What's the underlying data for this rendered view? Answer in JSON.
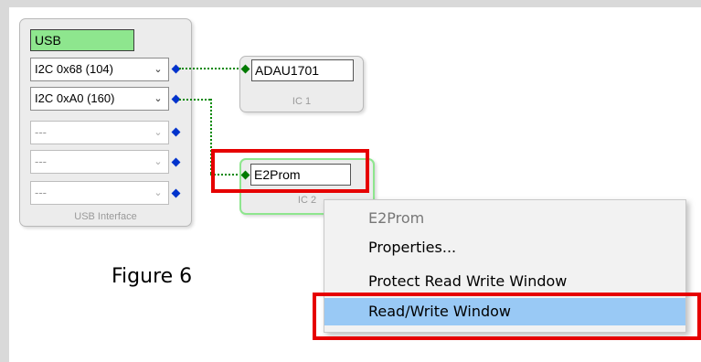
{
  "usb_interface": {
    "title": "USB",
    "footer": "USB Interface",
    "ports": [
      {
        "label": "I2C 0x68 (104)",
        "enabled": true
      },
      {
        "label": "I2C 0xA0 (160)",
        "enabled": true
      },
      {
        "label": "---",
        "enabled": false
      },
      {
        "label": "---",
        "enabled": false
      },
      {
        "label": "---",
        "enabled": false
      }
    ]
  },
  "ic1": {
    "name": "ADAU1701",
    "sub": "IC 1"
  },
  "ic2": {
    "name": "E2Prom",
    "sub": "IC 2"
  },
  "context_menu": {
    "items": [
      {
        "label": "E2Prom",
        "type": "header"
      },
      {
        "label": "Properties..."
      },
      {
        "label": "Protect Read Write Window"
      },
      {
        "label": "Read/Write Window",
        "selected": true
      }
    ]
  },
  "caption": "Figure 6",
  "colors": {
    "usb_title_bg": "#8ee68e",
    "wire": "#008800",
    "pin": "#0033cc",
    "highlight": "#e60000",
    "menu_selected": "#99c9f5"
  },
  "icons": {
    "dropdown": "chevron-down-icon",
    "pin": "diamond-pin-icon"
  }
}
